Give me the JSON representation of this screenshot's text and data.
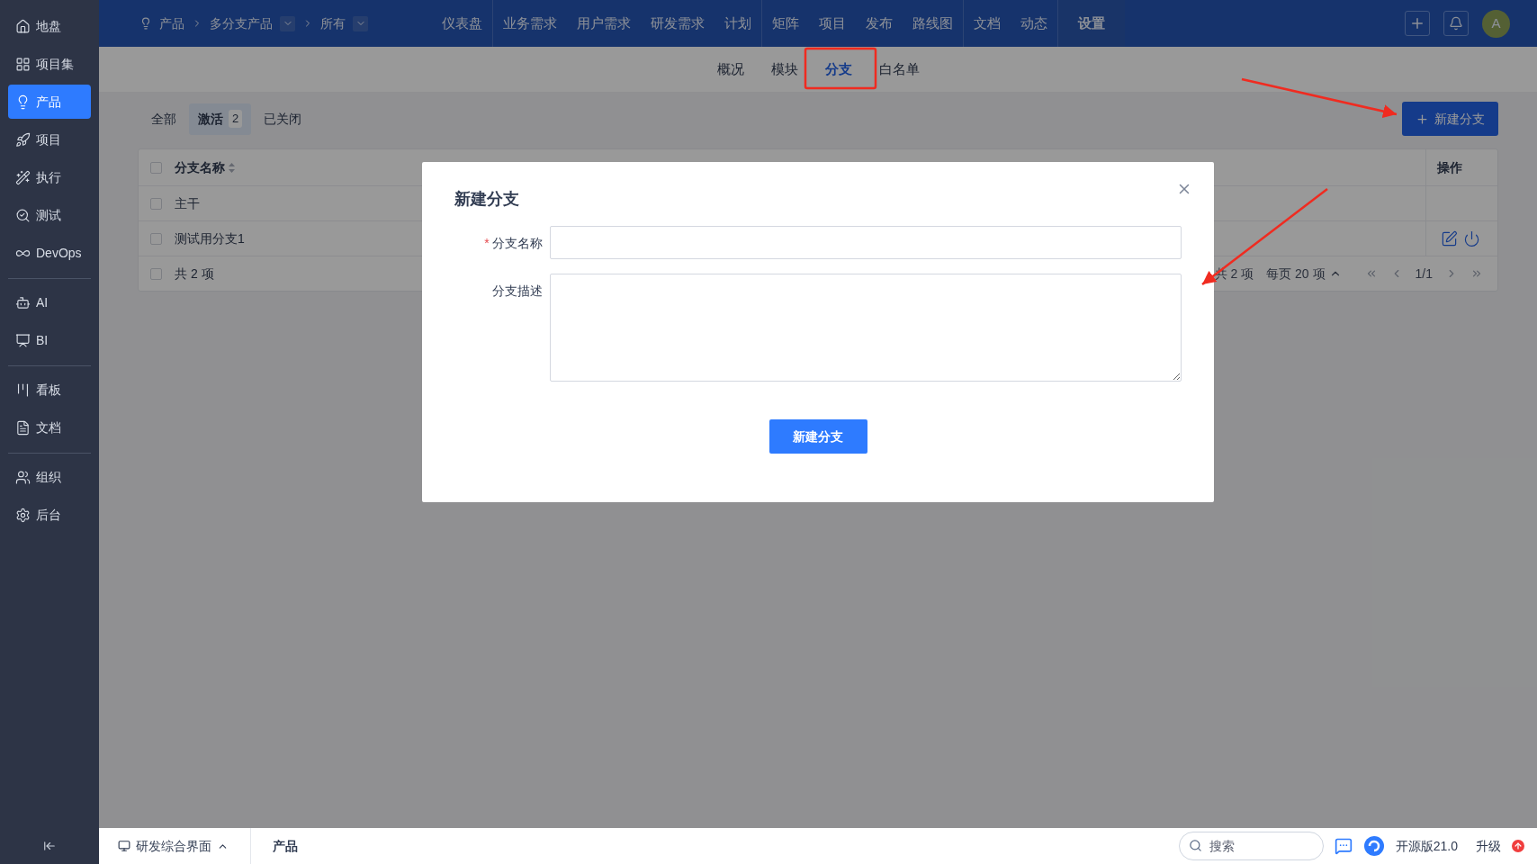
{
  "sidebar": {
    "groups": [
      [
        {
          "label": "地盘",
          "selected": false
        },
        {
          "label": "项目集",
          "selected": false
        },
        {
          "label": "产品",
          "selected": true
        },
        {
          "label": "项目",
          "selected": false
        },
        {
          "label": "执行",
          "selected": false
        },
        {
          "label": "测试",
          "selected": false
        },
        {
          "label": "DevOps",
          "selected": false
        }
      ],
      [
        {
          "label": "AI",
          "selected": false
        },
        {
          "label": "BI",
          "selected": false
        }
      ],
      [
        {
          "label": "看板",
          "selected": false
        },
        {
          "label": "文档",
          "selected": false
        }
      ],
      [
        {
          "label": "组织",
          "selected": false
        },
        {
          "label": "后台",
          "selected": false
        }
      ]
    ]
  },
  "topbar": {
    "breadcrumb": [
      {
        "label": "产品",
        "dropdown": false
      },
      {
        "label": "多分支产品",
        "dropdown": true
      },
      {
        "label": "所有",
        "dropdown": true
      }
    ],
    "nav_groups": [
      [
        {
          "label": "仪表盘",
          "selected": false
        }
      ],
      [
        {
          "label": "业务需求",
          "selected": false
        },
        {
          "label": "用户需求",
          "selected": false
        },
        {
          "label": "研发需求",
          "selected": false
        },
        {
          "label": "计划",
          "selected": false
        }
      ],
      [
        {
          "label": "矩阵",
          "selected": false
        },
        {
          "label": "项目",
          "selected": false
        },
        {
          "label": "发布",
          "selected": false
        },
        {
          "label": "路线图",
          "selected": false
        }
      ],
      [
        {
          "label": "文档",
          "selected": false
        },
        {
          "label": "动态",
          "selected": false
        }
      ],
      [
        {
          "label": "设置",
          "selected": true
        }
      ]
    ],
    "avatar": "A"
  },
  "subnav": [
    {
      "label": "概况",
      "selected": false
    },
    {
      "label": "模块",
      "selected": false
    },
    {
      "label": "分支",
      "selected": true
    },
    {
      "label": "白名单",
      "selected": false
    }
  ],
  "filters": [
    {
      "label": "全部",
      "selected": false
    },
    {
      "label": "激活",
      "count": "2",
      "selected": true
    },
    {
      "label": "已关闭",
      "selected": false
    }
  ],
  "create_button": "新建分支",
  "table": {
    "columns": [
      {
        "label": "分支名称"
      },
      {
        "label": "操作"
      }
    ],
    "select_all": {
      "checked": false
    },
    "rows": [
      {
        "name": "主干",
        "checked": false,
        "actions": false
      },
      {
        "name": "测试用分支1",
        "checked": false,
        "actions": true
      }
    ],
    "footer": {
      "checked": false,
      "total": "共 2 项",
      "summary": "共 2 项",
      "per_page": "每页 20 项",
      "page": "1/1"
    }
  },
  "modal": {
    "title": "新建分支",
    "fields": [
      {
        "label": "分支名称",
        "required": true,
        "required_mark": "*",
        "kind": "input"
      },
      {
        "label": "分支描述",
        "kind": "textarea"
      }
    ],
    "submit": "新建分支"
  },
  "bottombar": {
    "workspace": "研发综合界面",
    "crumb": "产品",
    "search_placeholder": "搜索",
    "version": "开源版21.0",
    "upgrade": "升级"
  }
}
